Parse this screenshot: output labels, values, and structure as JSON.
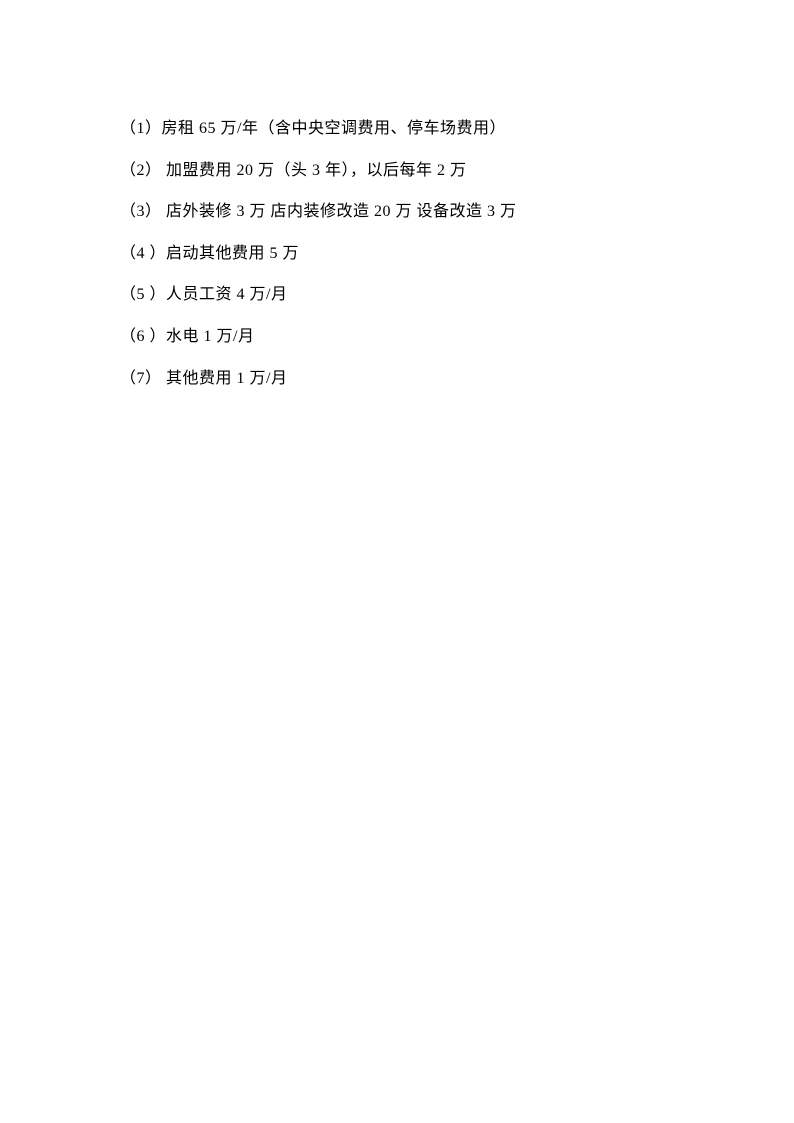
{
  "items": [
    "（1）房租 65 万/年（含中央空调费用、停车场费用）",
    "（2） 加盟费用 20 万（头 3 年），以后每年 2 万",
    "（3） 店外装修 3 万 店内装修改造 20 万 设备改造 3 万",
    "（4 ）启动其他费用 5 万",
    "（5 ）人员工资 4 万/月",
    "（6 ）水电 1 万/月",
    "（7） 其他费用 1 万/月"
  ]
}
